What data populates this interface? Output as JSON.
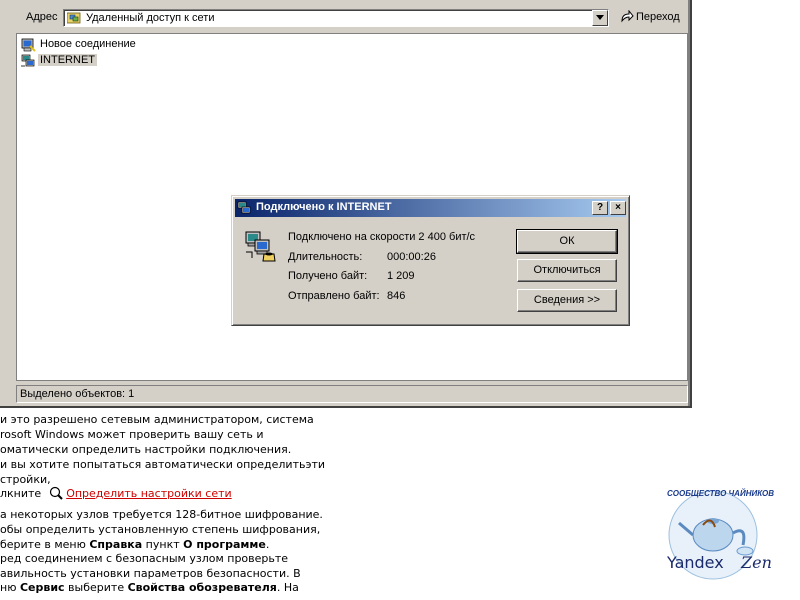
{
  "address_bar": {
    "label": "Адрес",
    "value": "Удаленный доступ к сети",
    "go_label": "Переход"
  },
  "explorer": {
    "items": [
      {
        "label": "Новое соединение"
      },
      {
        "label": "INTERNET"
      }
    ],
    "status": "Выделено объектов: 1"
  },
  "dialog": {
    "title": "Подключено к INTERNET",
    "help_glyph": "?",
    "close_glyph": "×",
    "speed_label": "Подключено на скорости 2 400 бит/с",
    "duration_label": "Длительность:",
    "duration_value": "000:00:26",
    "received_label": "Получено байт:",
    "received_value": "1 209",
    "sent_label": "Отправлено байт:",
    "sent_value": "846",
    "ok_label": "ОК",
    "disconnect_label": "Отключиться",
    "details_label": "Сведения >>"
  },
  "background_page": {
    "lines": [
      "и это разрешено сетевым администратором, система",
      "rosoft Windows может проверить вашу сеть и",
      "оматически определить настройки подключения.",
      "и вы хотите попытаться автоматически определитьэти",
      "стройки,"
    ],
    "click_prefix": "лкните",
    "link_text": "Определить настройки сети",
    "lines2": [
      "а некоторых узлов требуется 128-битное шифрование.",
      "обы определить установленную степень шифрования,"
    ],
    "menu_line_prefix": "берите в меню ",
    "menu_help": "Справка",
    "menu_item_word": " пункт ",
    "menu_about": "О программе",
    "menu_end": ".",
    "lines3": [
      "ред соединением с безопасным узлом проверьте",
      "авильность установки параметров безопасности. В"
    ],
    "service_prefix": "ню ",
    "service": "Сервис",
    "choose": " выберите ",
    "browser_props": "Свойства обозревателя",
    "service_end": ". На"
  },
  "logo": {
    "top_text": "СООБЩЕСТВО ЧАЙНИКОВ",
    "yandex": "Yandex",
    "zen": "Zen"
  },
  "colors": {
    "title_gradient_start": "#0a246a",
    "title_gradient_end": "#a6caf0",
    "link": "#cc0000",
    "face": "#d4d0c8"
  }
}
